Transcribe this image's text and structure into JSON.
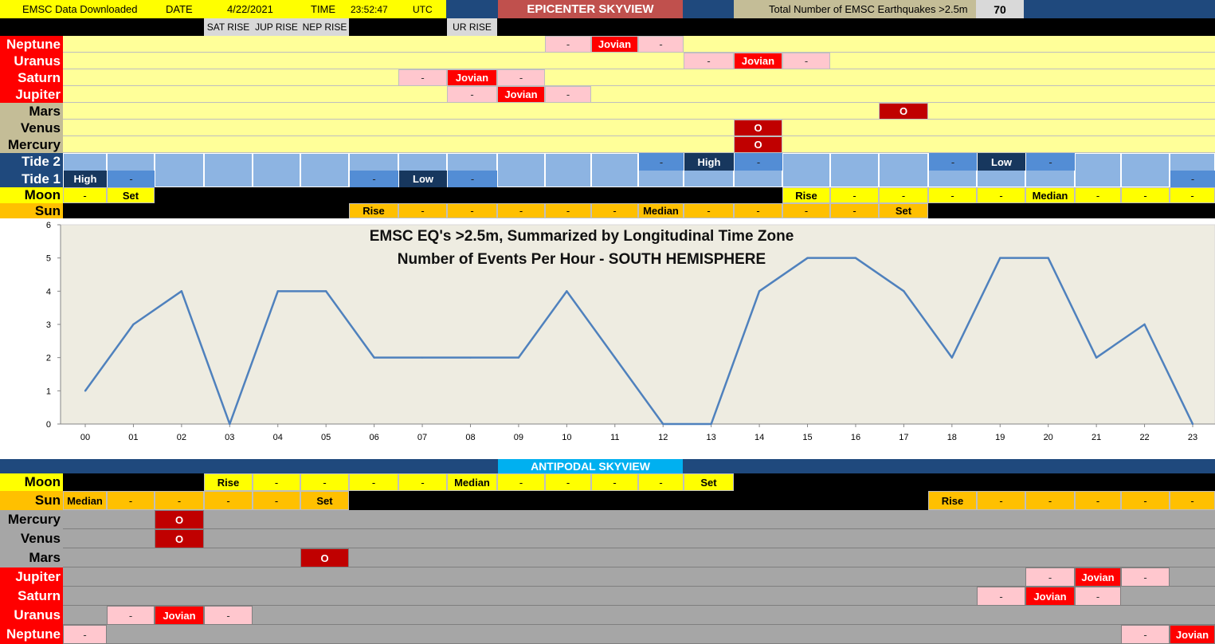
{
  "header": {
    "download_label": "EMSC Data Downloaded",
    "date_label": "DATE",
    "date_value": "4/22/2021",
    "time_label": "TIME",
    "time_value": "23:52:47",
    "tz_label": "UTC",
    "skyview_title": "EPICENTER SKYVIEW",
    "total_label": "Total Number of EMSC Earthquakes >2.5m",
    "total_value": "70",
    "rise_labels": [
      "SAT RISE",
      "JUP RISE",
      "NEP RISE",
      "UR RISE"
    ]
  },
  "epicenter": {
    "rows": [
      {
        "label": "Neptune",
        "cells": {
          "10": "-",
          "11": "Jovian",
          "12": "-"
        }
      },
      {
        "label": "Uranus",
        "cells": {
          "13": "-",
          "14": "Jovian",
          "15": "-"
        }
      },
      {
        "label": "Saturn",
        "cells": {
          "07": "-",
          "08": "Jovian",
          "09": "-"
        }
      },
      {
        "label": "Jupiter",
        "cells": {
          "08": "-",
          "09": "Jovian",
          "10": "-"
        }
      },
      {
        "label": "Mars",
        "cells": {
          "17": "O"
        }
      },
      {
        "label": "Venus",
        "cells": {
          "14": "O"
        }
      },
      {
        "label": "Mercury",
        "cells": {
          "14": "O"
        }
      }
    ],
    "tide2": {
      "label": "Tide 2",
      "cells": {
        "12": "-",
        "13": "High",
        "14": "-",
        "18": "-",
        "19": "Low",
        "20": "-"
      }
    },
    "tide1": {
      "label": "Tide 1",
      "cells": {
        "00": "High",
        "01": "-",
        "06": "-",
        "07": "Low",
        "08": "-",
        "23": "-"
      }
    },
    "moon": {
      "label": "Moon",
      "cells": {
        "00": "-",
        "01": "Set",
        "15": "Rise",
        "16": "-",
        "17": "-",
        "18": "-",
        "19": "-",
        "20": "Median",
        "21": "-",
        "22": "-",
        "23": "-"
      }
    },
    "sun": {
      "label": "Sun",
      "cells": {
        "06": "Rise",
        "07": "-",
        "08": "-",
        "09": "-",
        "10": "-",
        "11": "-",
        "12": "Median",
        "13": "-",
        "14": "-",
        "15": "-",
        "16": "-",
        "17": "Set"
      }
    }
  },
  "antipodal": {
    "title": "ANTIPODAL SKYVIEW",
    "moon": {
      "label": "Moon",
      "cells": {
        "03": "Rise",
        "04": "-",
        "05": "-",
        "06": "-",
        "07": "-",
        "08": "Median",
        "09": "-",
        "10": "-",
        "11": "-",
        "12": "-",
        "13": "Set"
      }
    },
    "sun": {
      "label": "Sun",
      "cells": {
        "00": "Median",
        "01": "-",
        "02": "-",
        "03": "-",
        "04": "-",
        "05": "Set",
        "18": "Rise",
        "19": "-",
        "20": "-",
        "21": "-",
        "22": "-",
        "23": "-"
      }
    },
    "rows": [
      {
        "label": "Mercury",
        "cells": {
          "02": "O"
        }
      },
      {
        "label": "Venus",
        "cells": {
          "02": "O"
        }
      },
      {
        "label": "Mars",
        "cells": {
          "05": "O"
        }
      },
      {
        "label": "Jupiter",
        "cells": {
          "20": "-",
          "21": "Jovian",
          "22": "-"
        }
      },
      {
        "label": "Saturn",
        "cells": {
          "19": "-",
          "20": "Jovian",
          "21": "-"
        }
      },
      {
        "label": "Uranus",
        "cells": {
          "01": "-",
          "02": "Jovian",
          "03": "-"
        }
      },
      {
        "label": "Neptune",
        "cells": {
          "00": "-",
          "22": "-",
          "23": "Jovian"
        }
      }
    ]
  },
  "chart_data": {
    "type": "line",
    "title": "EMSC EQ's >2.5m, Summarized by Longitudinal Time Zone",
    "subtitle": "Number of Events Per Hour - SOUTH HEMISPHERE",
    "categories": [
      "00",
      "01",
      "02",
      "03",
      "04",
      "05",
      "06",
      "07",
      "08",
      "09",
      "10",
      "11",
      "12",
      "13",
      "14",
      "15",
      "16",
      "17",
      "18",
      "19",
      "20",
      "21",
      "22",
      "23"
    ],
    "values": [
      1,
      3,
      4,
      0,
      4,
      4,
      2,
      2,
      2,
      2,
      4,
      2,
      0,
      0,
      4,
      5,
      5,
      4,
      2,
      5,
      5,
      2,
      3,
      0
    ],
    "ylim": [
      0,
      6
    ],
    "yticks": [
      "0",
      "1",
      "2",
      "3",
      "4",
      "5",
      "6"
    ],
    "grid": false,
    "colors": {
      "line": "#4f81bd",
      "plot_bg": "#eeece1"
    }
  },
  "colors": {
    "yellow": "#ffff99",
    "bright_yellow": "#ffff00",
    "orange": "#ffc000",
    "red": "#ff0000",
    "dark_red": "#c00000",
    "pink": "#ffc7ce",
    "tan": "#c4bd97",
    "navy": "#1f497d",
    "tide_light": "#8db4e2",
    "tide_mid": "#538dd5",
    "tide_dark": "#17375e",
    "gray": "#a6a6a6",
    "cyan": "#00b0f0"
  }
}
